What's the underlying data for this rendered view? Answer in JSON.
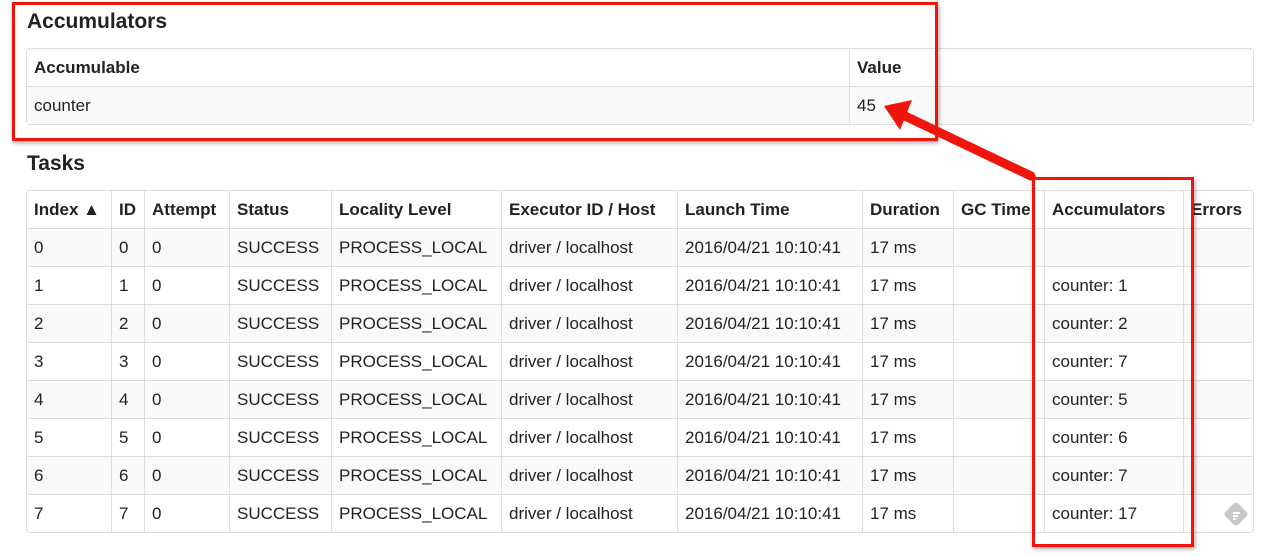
{
  "accumulators": {
    "title": "Accumulators",
    "headers": [
      "Accumulable",
      "Value"
    ],
    "rows": [
      [
        "counter",
        "45"
      ]
    ]
  },
  "tasks": {
    "title": "Tasks",
    "headers": [
      "Index ▲",
      "ID",
      "Attempt",
      "Status",
      "Locality Level",
      "Executor ID / Host",
      "Launch Time",
      "Duration",
      "GC Time",
      "Accumulators",
      "Errors"
    ],
    "rows": [
      [
        "0",
        "0",
        "0",
        "SUCCESS",
        "PROCESS_LOCAL",
        "driver / localhost",
        "2016/04/21 10:10:41",
        "17 ms",
        "",
        "",
        ""
      ],
      [
        "1",
        "1",
        "0",
        "SUCCESS",
        "PROCESS_LOCAL",
        "driver / localhost",
        "2016/04/21 10:10:41",
        "17 ms",
        "",
        "counter: 1",
        ""
      ],
      [
        "2",
        "2",
        "0",
        "SUCCESS",
        "PROCESS_LOCAL",
        "driver / localhost",
        "2016/04/21 10:10:41",
        "17 ms",
        "",
        "counter: 2",
        ""
      ],
      [
        "3",
        "3",
        "0",
        "SUCCESS",
        "PROCESS_LOCAL",
        "driver / localhost",
        "2016/04/21 10:10:41",
        "17 ms",
        "",
        "counter: 7",
        ""
      ],
      [
        "4",
        "4",
        "0",
        "SUCCESS",
        "PROCESS_LOCAL",
        "driver / localhost",
        "2016/04/21 10:10:41",
        "17 ms",
        "",
        "counter: 5",
        ""
      ],
      [
        "5",
        "5",
        "0",
        "SUCCESS",
        "PROCESS_LOCAL",
        "driver / localhost",
        "2016/04/21 10:10:41",
        "17 ms",
        "",
        "counter: 6",
        ""
      ],
      [
        "6",
        "6",
        "0",
        "SUCCESS",
        "PROCESS_LOCAL",
        "driver / localhost",
        "2016/04/21 10:10:41",
        "17 ms",
        "",
        "counter: 7",
        ""
      ],
      [
        "7",
        "7",
        "0",
        "SUCCESS",
        "PROCESS_LOCAL",
        "driver / localhost",
        "2016/04/21 10:10:41",
        "17 ms",
        "",
        "counter: 17",
        ""
      ]
    ]
  },
  "annotation_color": "#f0140a"
}
